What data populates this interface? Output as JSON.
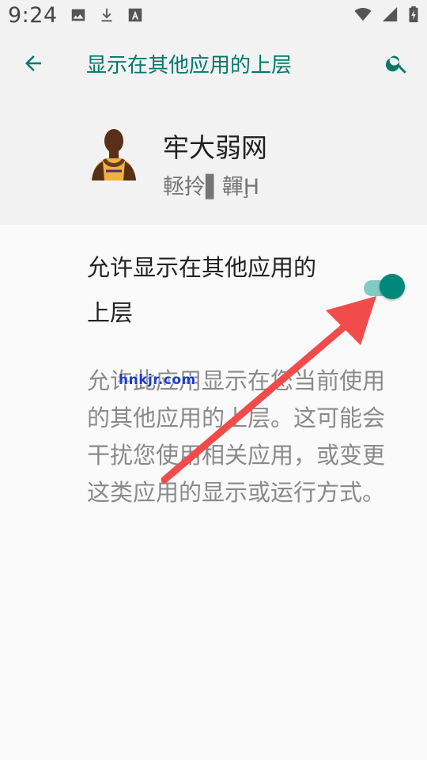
{
  "status_bar": {
    "time": "9:24",
    "left_icons": [
      "image-icon",
      "download-icon",
      "text-a-icon"
    ],
    "right_icons": [
      "wifi-icon",
      "signal-icon",
      "battery-charging-icon"
    ]
  },
  "app_bar": {
    "title": "显示在其他应用的上层",
    "back_icon": "arrow-left-icon",
    "search_icon": "search-icon",
    "accent_color": "#00796b"
  },
  "app_header": {
    "name": "牢大弱网",
    "subtitle": "䡕拎▌韗Ḩ"
  },
  "setting": {
    "label": "允许显示在其他应用的上层",
    "toggle_on": true
  },
  "description": "允许此应用显示在您当前使用的其他应用的上层。这可能会干扰您使用相关应用，或变更这类应用的显示或运行方式。",
  "watermark": "hnkjr.com",
  "annotation": {
    "arrow_color": "#f24b4b"
  }
}
